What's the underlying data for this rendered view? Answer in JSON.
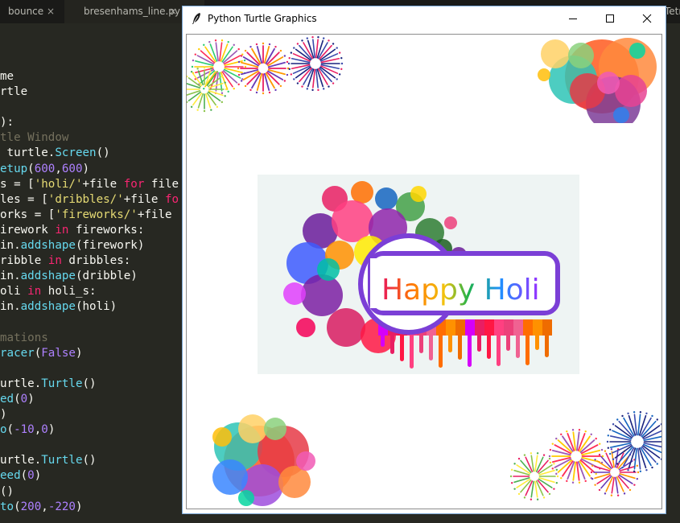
{
  "editor": {
    "tabs": [
      {
        "label": "bounce",
        "close": "×"
      },
      {
        "label": "bresenhams_line.py",
        "close": "×"
      },
      {
        "label": "Tetr"
      }
    ],
    "code_lines": [
      [
        {
          "t": "me",
          "c": "plain"
        }
      ],
      [
        {
          "t": "rtle",
          "c": "plain"
        }
      ],
      [
        {
          "t": "",
          "c": "plain"
        }
      ],
      [
        {
          "t": "):",
          "c": "plain"
        }
      ],
      [
        {
          "t": "tle Window",
          "c": "com"
        }
      ],
      [
        {
          "t": " turtle.",
          "c": "plain"
        },
        {
          "t": "Screen",
          "c": "fn"
        },
        {
          "t": "()",
          "c": "plain"
        }
      ],
      [
        {
          "t": "etup",
          "c": "fn"
        },
        {
          "t": "(",
          "c": "plain"
        },
        {
          "t": "600",
          "c": "num"
        },
        {
          "t": ",",
          "c": "plain"
        },
        {
          "t": "600",
          "c": "num"
        },
        {
          "t": ")",
          "c": "plain"
        }
      ],
      [
        {
          "t": "s = [",
          "c": "plain"
        },
        {
          "t": "'holi/'",
          "c": "str"
        },
        {
          "t": "+file ",
          "c": "plain"
        },
        {
          "t": "for",
          "c": "kw"
        },
        {
          "t": " file",
          "c": "plain"
        }
      ],
      [
        {
          "t": "les = [",
          "c": "plain"
        },
        {
          "t": "'dribbles/'",
          "c": "str"
        },
        {
          "t": "+file ",
          "c": "plain"
        },
        {
          "t": "fo",
          "c": "kw"
        }
      ],
      [
        {
          "t": "orks = [",
          "c": "plain"
        },
        {
          "t": "'fireworks/'",
          "c": "str"
        },
        {
          "t": "+file",
          "c": "plain"
        }
      ],
      [
        {
          "t": "irework ",
          "c": "plain"
        },
        {
          "t": "in",
          "c": "kw"
        },
        {
          "t": " fireworks:",
          "c": "plain"
        }
      ],
      [
        {
          "t": "in.",
          "c": "plain"
        },
        {
          "t": "addshape",
          "c": "fn"
        },
        {
          "t": "(firework)",
          "c": "plain"
        }
      ],
      [
        {
          "t": "ribble ",
          "c": "plain"
        },
        {
          "t": "in",
          "c": "kw"
        },
        {
          "t": " dribbles:",
          "c": "plain"
        }
      ],
      [
        {
          "t": "in.",
          "c": "plain"
        },
        {
          "t": "addshape",
          "c": "fn"
        },
        {
          "t": "(dribble)",
          "c": "plain"
        }
      ],
      [
        {
          "t": "oli ",
          "c": "plain"
        },
        {
          "t": "in",
          "c": "kw"
        },
        {
          "t": " holi_s:",
          "c": "plain"
        }
      ],
      [
        {
          "t": "in.",
          "c": "plain"
        },
        {
          "t": "addshape",
          "c": "fn"
        },
        {
          "t": "(holi)",
          "c": "plain"
        }
      ],
      [
        {
          "t": "",
          "c": "plain"
        }
      ],
      [
        {
          "t": "mations",
          "c": "com"
        }
      ],
      [
        {
          "t": "racer",
          "c": "fn"
        },
        {
          "t": "(",
          "c": "plain"
        },
        {
          "t": "False",
          "c": "num"
        },
        {
          "t": ")",
          "c": "plain"
        }
      ],
      [
        {
          "t": "",
          "c": "plain"
        }
      ],
      [
        {
          "t": "urtle.",
          "c": "plain"
        },
        {
          "t": "Turtle",
          "c": "fn"
        },
        {
          "t": "()",
          "c": "plain"
        }
      ],
      [
        {
          "t": "ed",
          "c": "fn"
        },
        {
          "t": "(",
          "c": "plain"
        },
        {
          "t": "0",
          "c": "num"
        },
        {
          "t": ")",
          "c": "plain"
        }
      ],
      [
        {
          "t": ")",
          "c": "plain"
        }
      ],
      [
        {
          "t": "o",
          "c": "fn"
        },
        {
          "t": "(",
          "c": "plain"
        },
        {
          "t": "-10",
          "c": "num"
        },
        {
          "t": ",",
          "c": "plain"
        },
        {
          "t": "0",
          "c": "num"
        },
        {
          "t": ")",
          "c": "plain"
        }
      ],
      [
        {
          "t": "",
          "c": "plain"
        }
      ],
      [
        {
          "t": "urtle.",
          "c": "plain"
        },
        {
          "t": "Turtle",
          "c": "fn"
        },
        {
          "t": "()",
          "c": "plain"
        }
      ],
      [
        {
          "t": "eed",
          "c": "fn"
        },
        {
          "t": "(",
          "c": "plain"
        },
        {
          "t": "0",
          "c": "num"
        },
        {
          "t": ")",
          "c": "plain"
        }
      ],
      [
        {
          "t": "()",
          "c": "plain"
        }
      ],
      [
        {
          "t": "to",
          "c": "fn"
        },
        {
          "t": "(",
          "c": "plain"
        },
        {
          "t": "200",
          "c": "num"
        },
        {
          "t": ",",
          "c": "plain"
        },
        {
          "t": "-220",
          "c": "num"
        },
        {
          "t": ")",
          "c": "plain"
        }
      ]
    ],
    "colors": {
      "keyword": "#f92672",
      "string": "#e6db74",
      "function": "#66d9ef",
      "number": "#ae81ff",
      "comment": "#75715e",
      "text": "#f8f8f2"
    }
  },
  "window": {
    "title": "Python Turtle Graphics",
    "icon": "feather-icon",
    "controls": [
      {
        "name": "minimize-icon",
        "label": "minimize"
      },
      {
        "name": "maximize-icon",
        "label": "maximize"
      },
      {
        "name": "close-icon",
        "label": "close"
      }
    ]
  },
  "canvas": {
    "banner_text": "Happy Holi",
    "shapes": [
      "fireworks",
      "dribbles",
      "holi",
      "dribbles",
      "fireworks"
    ]
  }
}
